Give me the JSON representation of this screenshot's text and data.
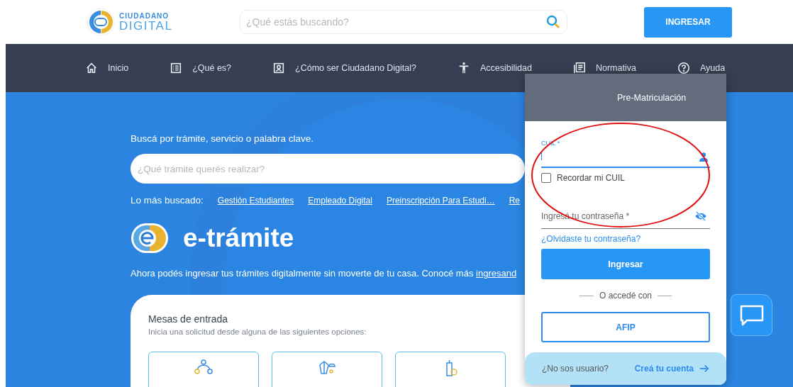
{
  "header": {
    "logo": {
      "line1": "CIUDADANO",
      "line2": "DIGITAL"
    },
    "search": {
      "placeholder": "¿Qué estás buscando?"
    },
    "login_button": "INGRESAR"
  },
  "nav": [
    {
      "label": "Inicio",
      "kind": "home"
    },
    {
      "label": "¿Qué es?",
      "kind": "list"
    },
    {
      "label": "¿Cómo ser Ciudadano Digital?",
      "kind": "badge"
    },
    {
      "label": "Accesibilidad",
      "kind": "figure"
    },
    {
      "label": "Normativa",
      "kind": "document"
    },
    {
      "label": "Ayuda",
      "kind": "help"
    }
  ],
  "hero": {
    "search_prompt": "Buscá por trámite, servicio o palabra clave.",
    "search": {
      "placeholder": "¿Qué trámite querés realizar?"
    },
    "popular_label": "Lo más buscado:",
    "popular_links": [
      "Gestión Estudiantes",
      "Empleado Digital",
      "Preinscripción Para Estudi…",
      "Re"
    ],
    "brand": "e-trámite",
    "description": "Ahora podés ingresar tus trámites digitalmente sin moverte de tu casa. Conocé más",
    "description_link": "ingresand"
  },
  "card": {
    "title": "Mesas de entrada",
    "subtitle": "Inicia una solicitud desde alguna de las siguientes opciones:",
    "options": [
      {
        "kind": "people"
      },
      {
        "kind": "globe"
      },
      {
        "kind": "building"
      }
    ]
  },
  "login_panel": {
    "title": "Pre-Matriculación",
    "cuil_field": {
      "label": "CUIL *"
    },
    "remember": {
      "label": "Recordar mi CUIL",
      "checked": false
    },
    "password_field": {
      "placeholder": "Ingresá tu contraseña *"
    },
    "forgot_link": "¿Olvidaste tu contraseña?",
    "submit": "Ingresar",
    "divider_text": "O accedé con",
    "afip_button": "AFIP",
    "footer": {
      "question": "¿No sos usuario?",
      "link": "Creá tu cuenta"
    }
  }
}
